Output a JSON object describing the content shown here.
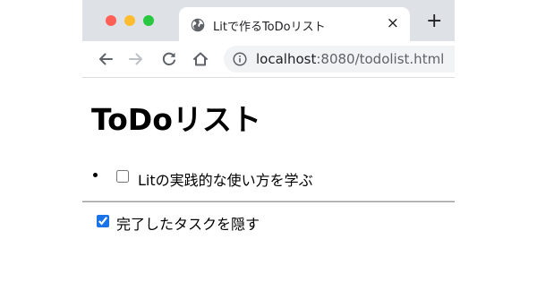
{
  "window": {
    "controls": [
      "close",
      "minimize",
      "zoom"
    ]
  },
  "tab": {
    "title": "Litで作るToDoリスト",
    "icon": "globe-icon",
    "close_label": "×"
  },
  "new_tab_label": "+",
  "toolbar": {
    "url_host": "localhost",
    "url_rest": ":8080/todolist.html"
  },
  "page": {
    "title": "ToDoリスト",
    "todos": [
      {
        "label": "Litの実践的な使い方を学ぶ",
        "checked": false
      }
    ],
    "hide_completed": {
      "label": "完了したタスクを隠す",
      "checked": true
    }
  }
}
